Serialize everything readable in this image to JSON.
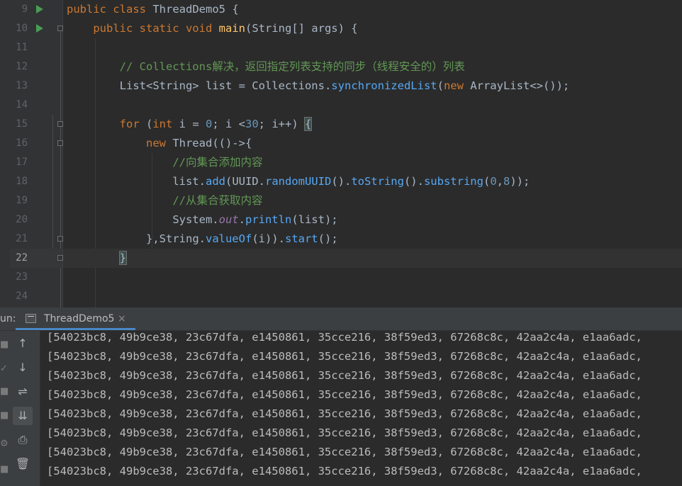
{
  "editor": {
    "lines": [
      {
        "num": "9",
        "html": "<span class=\"kw\">public class </span><span class=\"ty\">ThreadDemo5 </span><span class=\"pm\">{</span>",
        "run": true,
        "fold": false
      },
      {
        "num": "10",
        "html": "    <span class=\"kw\">public static void </span><span class=\"fn\">main</span><span class=\"pm\">(</span><span class=\"ty\">String</span><span class=\"pm\">[] args) {</span>",
        "run": true,
        "fold": true
      },
      {
        "num": "11",
        "html": "",
        "run": false,
        "fold": false
      },
      {
        "num": "12",
        "html": "        <span class=\"cm\">// Collections解决，返回指定列表支持的同步（线程安全的）列表</span>",
        "run": false,
        "fold": false
      },
      {
        "num": "13",
        "html": "        <span class=\"ty\">List&lt;String&gt; list = </span><span class=\"ty\">Collections</span><span class=\"pm\">.</span><span class=\"method\">synchronizedList</span><span class=\"pm\">(</span><span class=\"kw\">new </span><span class=\"ty\">ArrayList&lt;&gt;</span><span class=\"pm\">());</span>",
        "run": false,
        "fold": false
      },
      {
        "num": "14",
        "html": "",
        "run": false,
        "fold": false
      },
      {
        "num": "15",
        "html": "        <span class=\"kw\">for </span><span class=\"pm\">(</span><span class=\"kw\">int </span><span class=\"pm\">i = </span><span class=\"num\">0</span><span class=\"pm\">; i &lt;</span><span class=\"num\">30</span><span class=\"pm\">; i++) </span><span class=\"pm bracket-hl\">{</span>",
        "run": false,
        "fold": true
      },
      {
        "num": "16",
        "html": "            <span class=\"kw\">new </span><span class=\"ty\">Thread</span><span class=\"pm\">(()-&gt;{</span>",
        "run": false,
        "fold": true
      },
      {
        "num": "17",
        "html": "                <span class=\"cm\">//向集合添加内容</span>",
        "run": false,
        "fold": false
      },
      {
        "num": "18",
        "html": "                <span class=\"pm\">list.</span><span class=\"method\">add</span><span class=\"pm\">(UUID.</span><span class=\"method\">randomUUID</span><span class=\"pm\">().</span><span class=\"method\">toString</span><span class=\"pm\">().</span><span class=\"method\">substring</span><span class=\"pm\">(</span><span class=\"num\">0</span><span class=\"pm\">,</span><span class=\"num\">8</span><span class=\"pm\">));</span>",
        "run": false,
        "fold": false
      },
      {
        "num": "19",
        "html": "                <span class=\"cm\">//从集合获取内容</span>",
        "run": false,
        "fold": false
      },
      {
        "num": "20",
        "html": "                <span class=\"ty\">System.</span><span class=\"sf\">out</span><span class=\"pm\">.</span><span class=\"method\">println</span><span class=\"pm\">(list);</span>",
        "run": false,
        "fold": false
      },
      {
        "num": "21",
        "html": "            <span class=\"pm\">},</span><span class=\"ty\">String.</span><span class=\"method\">valueOf</span><span class=\"pm\">(i)).</span><span class=\"method\">start</span><span class=\"pm\">();</span>",
        "run": false,
        "fold": true
      },
      {
        "num": "22",
        "html": "        <span class=\"pm bracket-hl\">}</span>",
        "run": false,
        "fold": true,
        "current": true
      },
      {
        "num": "23",
        "html": "",
        "run": false,
        "fold": false
      },
      {
        "num": "24",
        "html": "",
        "run": false,
        "fold": false
      }
    ]
  },
  "run_panel": {
    "label": "un:",
    "tab_title": "ThreadDemo5",
    "tab_close": "×",
    "tools": [
      {
        "name": "up-arrow-icon",
        "glyph": "↑"
      },
      {
        "name": "down-arrow-icon",
        "glyph": "↓"
      },
      {
        "name": "soft-wrap-icon",
        "glyph": "⇌"
      },
      {
        "name": "scroll-to-end-icon",
        "glyph": "⇊",
        "active": true
      },
      {
        "name": "print-icon",
        "glyph": "⎙"
      },
      {
        "name": "trash-icon",
        "glyph": "🗑"
      }
    ],
    "output_lines": [
      "[54023bc8, 49b9ce38, 23c67dfa, e1450861, 35cce216, 38f59ed3, 67268c8c, 42aa2c4a, e1aa6adc,",
      "[54023bc8, 49b9ce38, 23c67dfa, e1450861, 35cce216, 38f59ed3, 67268c8c, 42aa2c4a, e1aa6adc,",
      "[54023bc8, 49b9ce38, 23c67dfa, e1450861, 35cce216, 38f59ed3, 67268c8c, 42aa2c4a, e1aa6adc,",
      "[54023bc8, 49b9ce38, 23c67dfa, e1450861, 35cce216, 38f59ed3, 67268c8c, 42aa2c4a, e1aa6adc,",
      "[54023bc8, 49b9ce38, 23c67dfa, e1450861, 35cce216, 38f59ed3, 67268c8c, 42aa2c4a, e1aa6adc,",
      "[54023bc8, 49b9ce38, 23c67dfa, e1450861, 35cce216, 38f59ed3, 67268c8c, 42aa2c4a, e1aa6adc,",
      "[54023bc8, 49b9ce38, 23c67dfa, e1450861, 35cce216, 38f59ed3, 67268c8c, 42aa2c4a, e1aa6adc,",
      "[54023bc8, 49b9ce38, 23c67dfa, e1450861, 35cce216, 38f59ed3, 67268c8c, 42aa2c4a, e1aa6adc,"
    ]
  },
  "colors": {
    "background": "#2b2b2b",
    "keyword": "#cc7832",
    "method": "#56a8f5",
    "comment": "#629755",
    "number": "#6897bb",
    "run_icon": "#499c54",
    "tab_underline": "#4a88c7"
  }
}
